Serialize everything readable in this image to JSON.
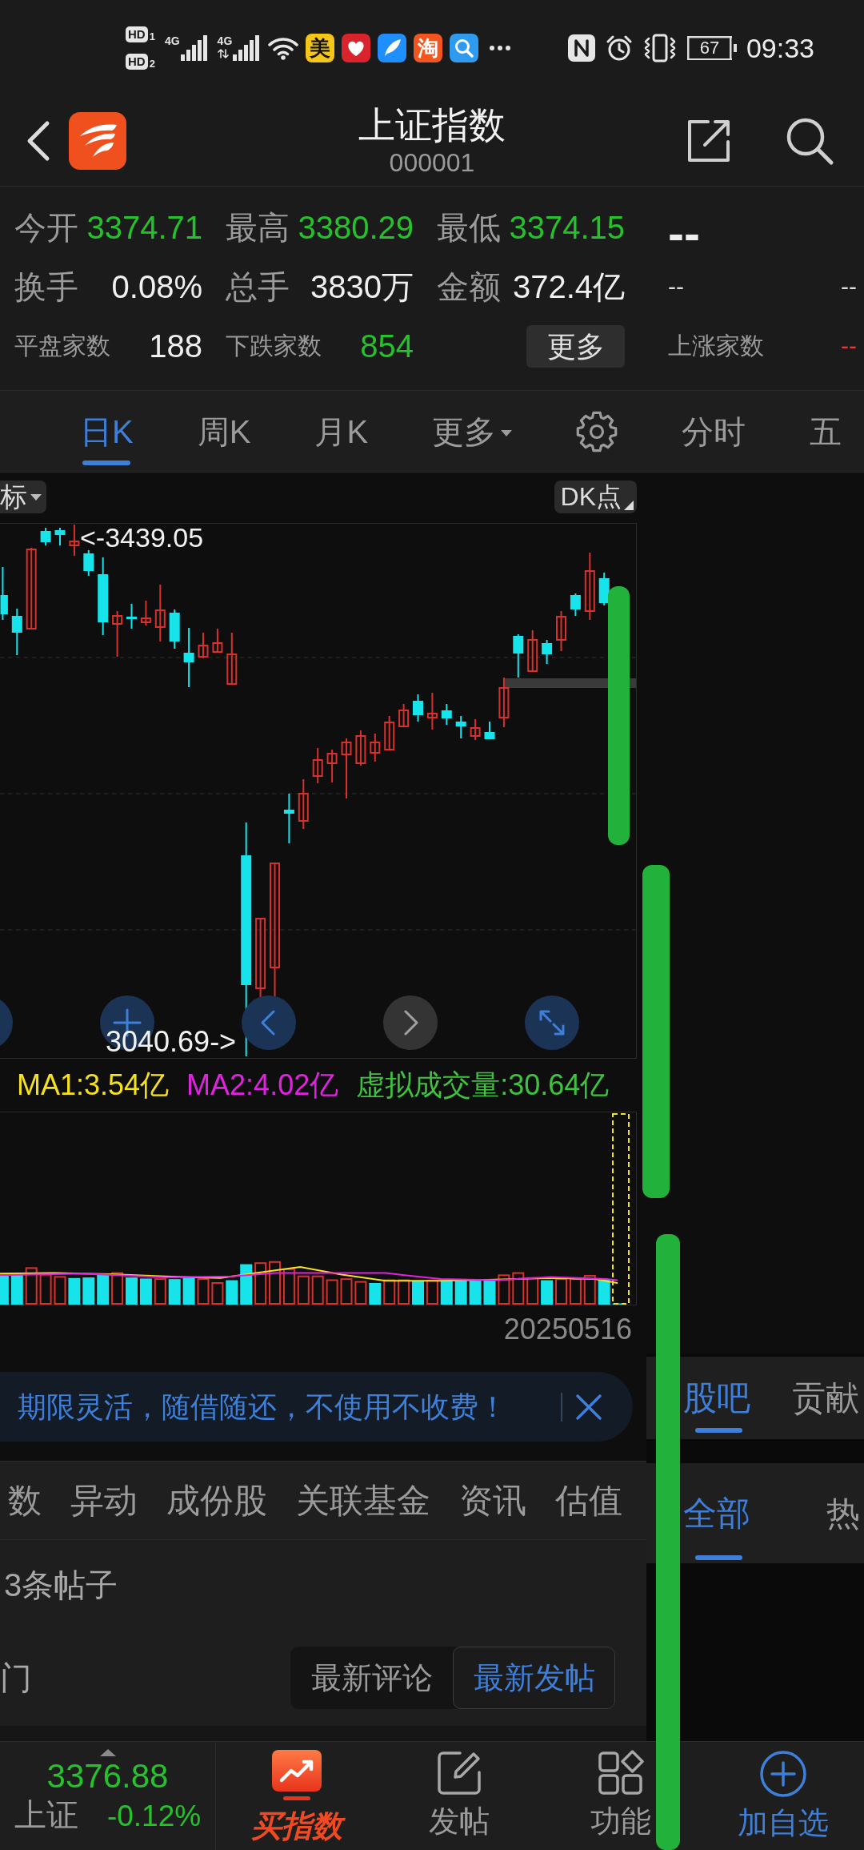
{
  "status_bar": {
    "hd_badges": [
      {
        "label": "HD",
        "slot": "1"
      },
      {
        "label": "HD",
        "slot": "2"
      }
    ],
    "signals": [
      {
        "network": "4G",
        "activity": false
      },
      {
        "network": "4G",
        "activity": true
      }
    ],
    "apps": [
      {
        "kind": "letter",
        "label": "美",
        "color": "#f5c518"
      },
      {
        "kind": "pattern",
        "color": "#d9232d"
      },
      {
        "kind": "feather",
        "color": "#1f8fff"
      },
      {
        "kind": "letter",
        "label": "淘",
        "color": "#f2551d"
      },
      {
        "kind": "search",
        "color": "#2f9bf0"
      }
    ],
    "battery": "67",
    "time": "09:33"
  },
  "header": {
    "title": "上证指数",
    "code": "000001"
  },
  "quote": {
    "stats": [
      {
        "label": "今开",
        "value": "3374.71",
        "color": "#25c22c"
      },
      {
        "label": "最高",
        "value": "3380.29",
        "color": "#25c22c"
      },
      {
        "label": "最低",
        "value": "3374.15",
        "color": "#25c22c"
      },
      {
        "label": "换手",
        "value": "0.08%",
        "color": "#f0f0f0"
      },
      {
        "label": "总手",
        "value": "3830万",
        "color": "#f0f0f0"
      },
      {
        "label": "金额",
        "value": "372.4亿",
        "color": "#f0f0f0"
      }
    ],
    "breadth": [
      {
        "label": "平盘家数",
        "value": "188",
        "color": "#f0f0f0"
      },
      {
        "label": "下跌家数",
        "value": "854",
        "color": "#25c22c"
      }
    ],
    "more_button": "更多",
    "side": {
      "big_value": "--",
      "row_2": [
        "--",
        "--"
      ],
      "breadth": {
        "label": "上涨家数",
        "value": "--",
        "color": "#e23a36"
      }
    }
  },
  "chart_tabs": [
    {
      "kind": "tab",
      "label": "日K",
      "selected": true
    },
    {
      "kind": "tab",
      "label": "周K",
      "selected": false
    },
    {
      "kind": "tab",
      "label": "月K",
      "selected": false
    },
    {
      "kind": "dropdown",
      "label": "更多",
      "selected": false
    },
    {
      "kind": "settings",
      "selected": false
    },
    {
      "kind": "tab",
      "label": "分时",
      "selected": false
    },
    {
      "kind": "tab",
      "label": "五",
      "selected": false
    }
  ],
  "chart": {
    "indicator_button": "标",
    "dk_button": "DK点",
    "high_label": "<-3439.05",
    "low_label": "3040.69->",
    "controls": [
      {
        "kind": "edge",
        "disabled": false
      },
      {
        "kind": "zoom_in",
        "disabled": false
      },
      {
        "kind": "prev",
        "disabled": false
      },
      {
        "kind": "next",
        "disabled": true
      },
      {
        "kind": "expand",
        "disabled": false
      }
    ]
  },
  "volume": {
    "legend": [
      {
        "text": "MA1:3.54亿",
        "color": "#f5e11d"
      },
      {
        "text": "MA2:4.02亿",
        "color": "#e023e0"
      },
      {
        "text": "虚拟成交量:30.64亿",
        "color": "#3fc23f"
      }
    ],
    "date": "20250516"
  },
  "banner": {
    "text": "期限灵活，随借随还，不使用不收费！"
  },
  "info_tabs": [
    {
      "label": "数",
      "selected": false
    },
    {
      "label": "异动",
      "selected": false
    },
    {
      "label": "成份股",
      "selected": false
    },
    {
      "label": "关联基金",
      "selected": false
    },
    {
      "label": "资讯",
      "selected": false
    },
    {
      "label": "估值",
      "selected": false
    }
  ],
  "posts": {
    "count": "3条帖子",
    "filter": "门",
    "sort": [
      {
        "label": "最新评论",
        "selected": false
      },
      {
        "label": "最新发帖",
        "selected": true
      }
    ]
  },
  "side_panel": {
    "tabs": [
      {
        "label": "股吧",
        "selected": true
      },
      {
        "label": "贡献",
        "selected": false
      }
    ],
    "subtabs": [
      {
        "label": "全部",
        "selected": true
      },
      {
        "label": "热",
        "selected": false
      }
    ]
  },
  "bottom_nav": {
    "index": {
      "price": "3376.88",
      "name": "上证",
      "change": "-0.12%",
      "color": "#25c22c"
    },
    "items": [
      {
        "kind": "buy",
        "label": "买指数"
      },
      {
        "kind": "post",
        "label": "发帖"
      },
      {
        "kind": "tools",
        "label": "功能"
      },
      {
        "kind": "add",
        "label": "加自选"
      }
    ]
  }
}
